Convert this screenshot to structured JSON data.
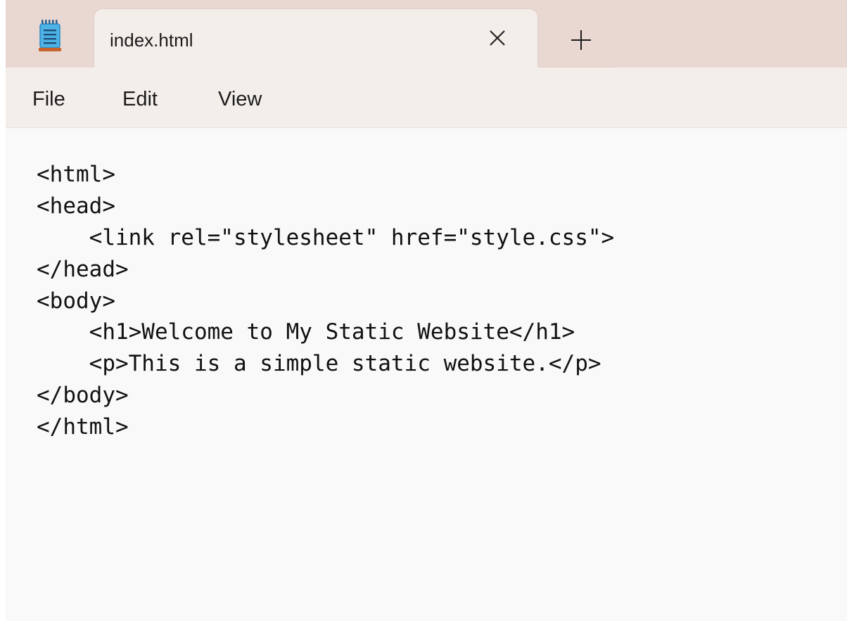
{
  "tab": {
    "title": "index.html"
  },
  "menu": {
    "items": [
      "File",
      "Edit",
      "View"
    ]
  },
  "editor": {
    "lines": [
      "<html>",
      "<head>",
      "    <link rel=\"stylesheet\" href=\"style.css\">",
      "</head>",
      "<body>",
      "    <h1>Welcome to My Static Website</h1>",
      "    <p>This is a simple static website.</p>",
      "</body>",
      "</html>"
    ]
  },
  "icons": {
    "app": "notepad-icon",
    "close": "close-icon",
    "new_tab": "plus-icon"
  },
  "colors": {
    "titlebar": "#e9d8d2",
    "tab": "#f4eeeb",
    "editor": "#f9f9f9",
    "icon_blue": "#3aa0d8",
    "icon_orange": "#c9612a"
  }
}
